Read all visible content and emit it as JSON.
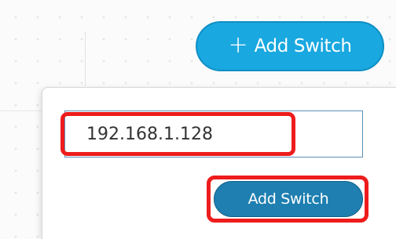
{
  "toolbar": {
    "add_switch_icon": "plus-icon",
    "add_switch_label": "Add Switch",
    "accent_color": "#19a8e0"
  },
  "add_switch_popover": {
    "ip_input_value": "192.168.1.128",
    "submit_label": "Add Switch",
    "button_color": "#1e7fb0"
  },
  "annotations": {
    "highlight_color": "#ee1c1c"
  }
}
